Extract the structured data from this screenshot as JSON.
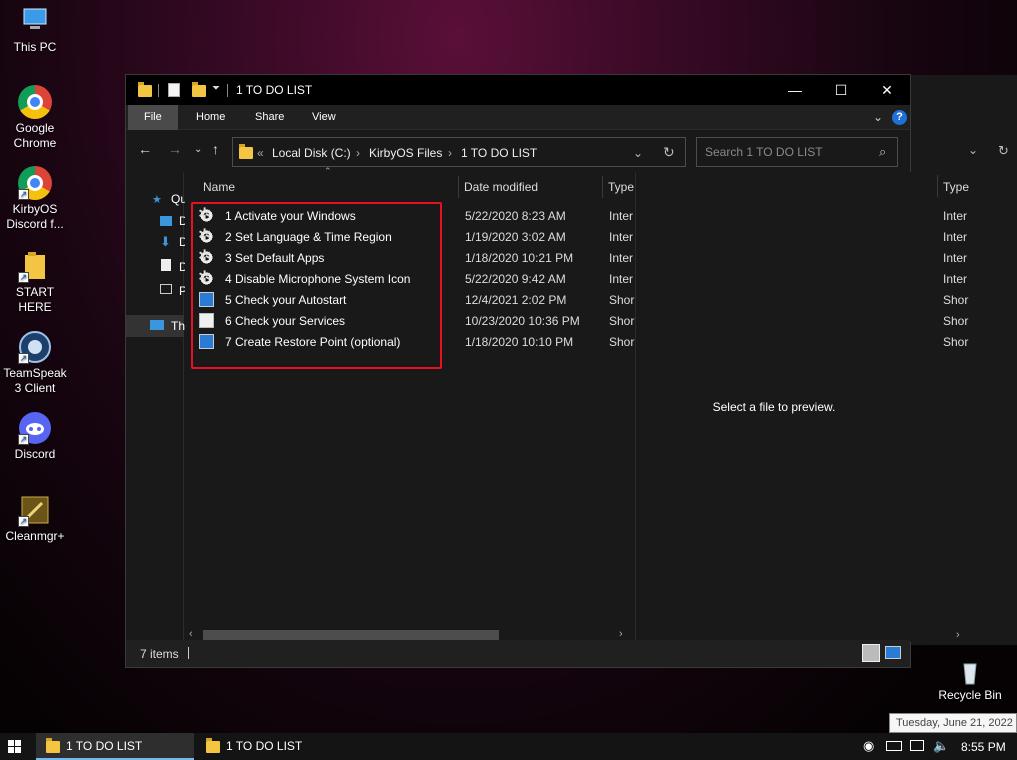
{
  "desktop": {
    "icons": [
      {
        "label": "This PC",
        "icon": "monitor-icon"
      },
      {
        "label": "Google Chrome",
        "icon": "chrome-icon"
      },
      {
        "label": "KirbyOS Discord f...",
        "icon": "chrome-icon"
      },
      {
        "label": "START HERE",
        "icon": "folder-icon"
      },
      {
        "label": "TeamSpeak 3 Client",
        "icon": "teamspeak-icon"
      },
      {
        "label": "Discord",
        "icon": "discord-icon"
      },
      {
        "label": "Cleanmgr+",
        "icon": "cleanmgr-icon"
      },
      {
        "label": "Recycle Bin",
        "icon": "recycle-bin-icon"
      }
    ]
  },
  "window": {
    "title": "1 TO DO LIST",
    "controls": {
      "minimize": "—",
      "maximize": "☐",
      "close": "✕"
    },
    "ribbon": {
      "file": "File",
      "home": "Home",
      "share": "Share",
      "view": "View",
      "help": "?"
    },
    "address": {
      "prefix": "«",
      "parts": [
        "Local Disk (C:)",
        "KirbyOS Files",
        "1 TO DO LIST"
      ],
      "sep": "›"
    },
    "search_placeholder": "Search 1 TO DO LIST",
    "nav_items": [
      {
        "label": "Qu"
      },
      {
        "label": "D"
      },
      {
        "label": "D"
      },
      {
        "label": "D"
      },
      {
        "label": "P"
      },
      {
        "label": "Th"
      }
    ],
    "columns": {
      "name": "Name",
      "date": "Date modified",
      "type": "Type"
    },
    "files": [
      {
        "name": "1 Activate your Windows",
        "date": "5/22/2020 8:23 AM",
        "type": "Inter",
        "icon": "gear-icon"
      },
      {
        "name": "2 Set Language & Time Region",
        "date": "1/19/2020 3:02 AM",
        "type": "Inter",
        "icon": "gear-icon"
      },
      {
        "name": "3 Set Default Apps",
        "date": "1/18/2020 10:21 PM",
        "type": "Inter",
        "icon": "gear-icon"
      },
      {
        "name": "4 Disable Microphone System Icon",
        "date": "5/22/2020 9:42 AM",
        "type": "Inter",
        "icon": "gear-icon"
      },
      {
        "name": "5 Check your Autostart",
        "date": "12/4/2021 2:02 PM",
        "type": "Shor",
        "icon": "app-icon"
      },
      {
        "name": "6 Check your Services",
        "date": "10/23/2020 10:36 PM",
        "type": "Shor",
        "icon": "document-icon"
      },
      {
        "name": "7 Create Restore Point (optional)",
        "date": "1/18/2020 10:10 PM",
        "type": "Shor",
        "icon": "app-icon"
      }
    ],
    "preview_message": "Select a file to preview.",
    "status": "7 items"
  },
  "background_window": {
    "type_header": "Type",
    "types": [
      "Inter",
      "Inter",
      "Inter",
      "Inter",
      "Shor",
      "Shor",
      "Shor"
    ]
  },
  "taskbar": {
    "items": [
      "1 TO DO LIST",
      "1 TO DO LIST"
    ],
    "time": "8:55 PM",
    "date_tooltip": "Tuesday, June 21, 2022"
  },
  "colors": {
    "highlight": "#e81123",
    "accent": "#76b9ed",
    "window_bg": "#191919"
  }
}
